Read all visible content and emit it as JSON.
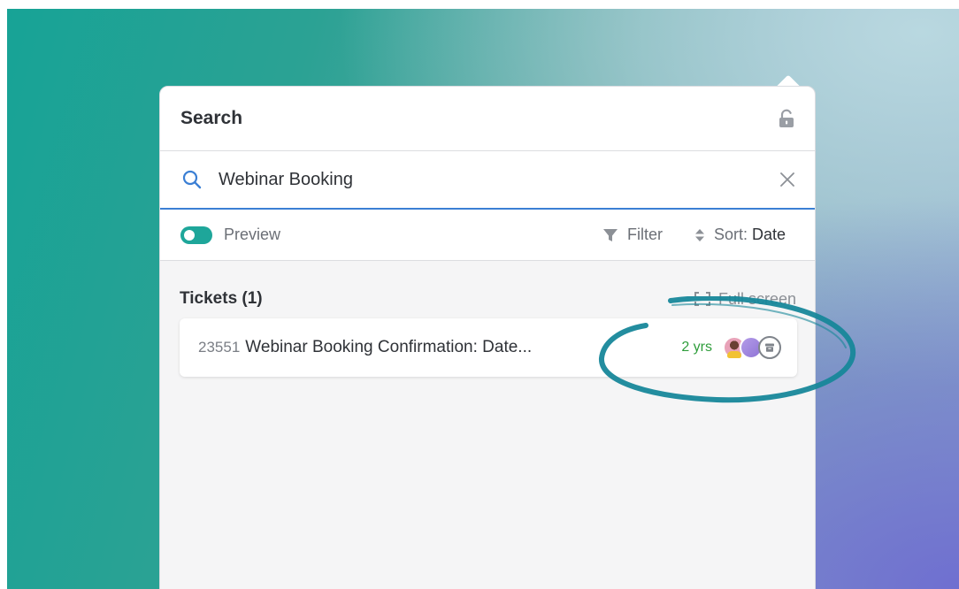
{
  "panel": {
    "title": "Search",
    "icons": {
      "lock": "unlock-icon",
      "search": "search-icon",
      "clear": "close-icon"
    }
  },
  "search": {
    "value": "Webinar Booking",
    "placeholder": "Search"
  },
  "toolbar": {
    "preview_label": "Preview",
    "preview_enabled": true,
    "filter_label": "Filter",
    "sort_label": "Sort:",
    "sort_value": "Date"
  },
  "results": {
    "section_title": "Tickets (1)",
    "fullscreen_label": "Full screen",
    "tickets": [
      {
        "id": "23551",
        "title": "Webinar Booking Confirmation: Date...",
        "age": "2 yrs",
        "status_icon": "archive-icon"
      }
    ]
  },
  "colors": {
    "accent": "#3b7fd4",
    "toggle": "#1ea69a",
    "age": "#2e9d3b",
    "annotation": "#17879a"
  }
}
